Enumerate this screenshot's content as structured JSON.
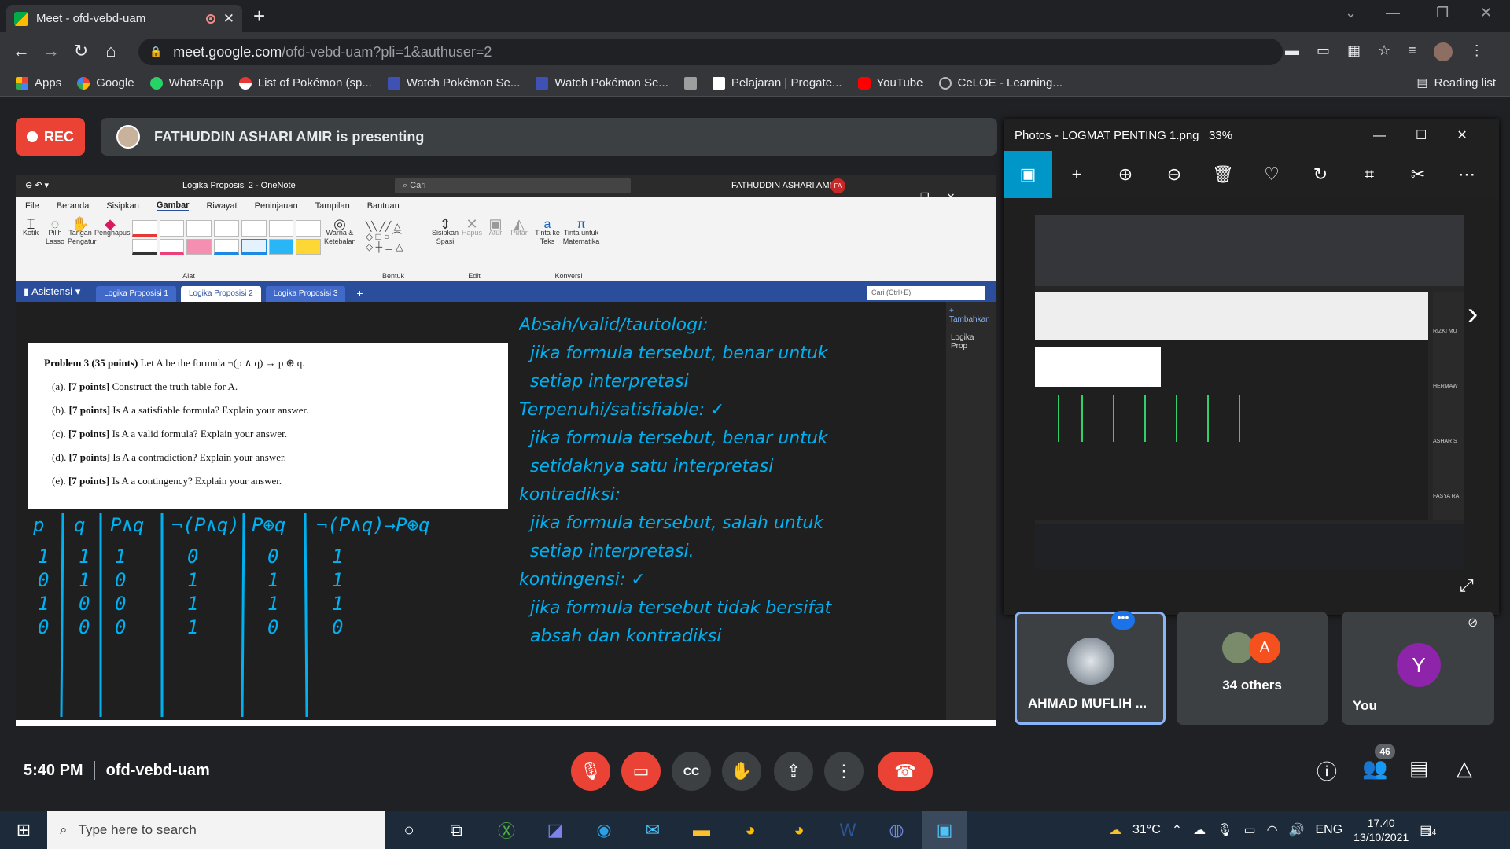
{
  "browser": {
    "tab_title": "Meet - ofd-vebd-uam",
    "url_host": "meet.google.com",
    "url_path": "/ofd-vebd-uam?pli=1&authuser=2",
    "bookmarks": [
      "Apps",
      "Google",
      "WhatsApp",
      "List of Pokémon (sp...",
      "Watch Pokémon Se...",
      "Watch Pokémon Se...",
      "Pelajaran | Progate...",
      "YouTube",
      "CeLOE - Learning..."
    ],
    "reading_list": "Reading list"
  },
  "meet": {
    "rec_label": "REC",
    "presenter_text": "FATHUDDIN ASHARI AMIR is presenting",
    "time": "5:40 PM",
    "meeting_code": "ofd-vebd-uam",
    "participant_count": "46",
    "tiles": [
      {
        "name": "AHMAD MUFLIH ..."
      },
      {
        "name": "34 others",
        "initial": "A"
      },
      {
        "name": "You",
        "initial": "Y"
      }
    ]
  },
  "onenote": {
    "title": "Logika Proposisi 2 - OneNote",
    "search": "Cari",
    "user": "FATHUDDIN ASHARI AMIR",
    "user_initials": "FA",
    "tabs": [
      "File",
      "Beranda",
      "Sisipkan",
      "Gambar",
      "Riwayat",
      "Peninjauan",
      "Tampilan",
      "Bantuan"
    ],
    "ribbon": {
      "tools": [
        "Ketik",
        "Pilih Lasso",
        "Tangan Pengatur",
        "Penghapus"
      ],
      "color": "Warna & Ketebalan",
      "sisipkan": "Sisipkan Spasi",
      "hapus": "Hapus",
      "atur": "Atur",
      "putar": "Putar",
      "tinta_teks": "Tinta ke Teks",
      "tinta_mat": "Tinta untuk Matematika",
      "groups": [
        "Alat",
        "Bentuk",
        "Edit",
        "Konversi"
      ]
    },
    "notebook": "Asistensi",
    "sections": [
      "Logika Proposisi 1",
      "Logika Proposisi 2",
      "Logika Proposisi 3"
    ],
    "search_section": "Cari (Ctrl+E)",
    "add_page": "Tambahkan",
    "page_item": "Logika Prop",
    "problem": {
      "heading": "Problem 3 (35 points)",
      "intro": "Let A be the formula ¬(p ∧ q) → p ⊕ q.",
      "items": [
        {
          "tag": "(a).",
          "pts": "[7 points]",
          "text": "Construct the truth table for A."
        },
        {
          "tag": "(b).",
          "pts": "[7 points]",
          "text": "Is A a satisfiable formula? Explain your answer."
        },
        {
          "tag": "(c).",
          "pts": "[7 points]",
          "text": "Is A a valid formula? Explain your answer."
        },
        {
          "tag": "(d).",
          "pts": "[7 points]",
          "text": "Is A a contradiction? Explain your answer."
        },
        {
          "tag": "(e).",
          "pts": "[7 points]",
          "text": "Is A a contingency? Explain your answer."
        }
      ]
    },
    "truth_table": {
      "headers": [
        "p",
        "q",
        "P∧q",
        "¬(P∧q)",
        "P⊕q",
        "¬(P∧q)→P⊕q"
      ],
      "rows": [
        [
          "1",
          "1",
          "1",
          "0",
          "0",
          "1"
        ],
        [
          "0",
          "1",
          "0",
          "1",
          "1",
          "1"
        ],
        [
          "1",
          "0",
          "0",
          "1",
          "1",
          "1"
        ],
        [
          "0",
          "0",
          "0",
          "1",
          "0",
          "0"
        ]
      ]
    },
    "notes": [
      "Absah/valid/tautologi:",
      "jika formula tersebut, benar untuk",
      "setiap interpretasi",
      "Terpenuhi/satisfiable: ✓",
      "jika formula tersebut, benar untuk",
      "setidaknya satu interpretasi",
      "kontradiksi:",
      "jika formula tersebut, salah untuk",
      "setiap interpretasi.",
      "kontingensi: ✓",
      "jika formula tersebut tidak bersifat",
      "absah dan kontradiksi"
    ]
  },
  "photos": {
    "title": "Photos - LOGMAT PENTING 1.png",
    "zoom": "33%",
    "thumb_names": [
      "RIZKI MU",
      "HERMAW",
      "ASHAR S",
      "FASYA RA"
    ]
  },
  "taskbar": {
    "search": "Type here to search",
    "temp": "31°C",
    "lang": "ENG",
    "time": "17.40",
    "date": "13/10/2021",
    "notif": "14"
  },
  "colors": {
    "accent": "#8ab4f8",
    "red": "#ea4335",
    "ink": "#00b0f0",
    "green_ink": "#2fcf6a"
  }
}
